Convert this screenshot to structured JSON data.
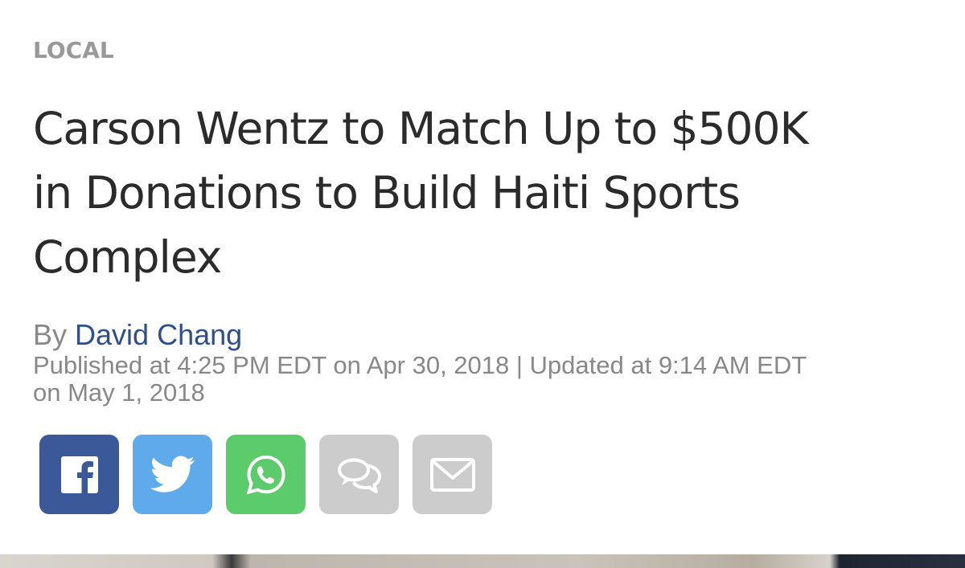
{
  "article": {
    "category": "LOCAL",
    "headline_lines": [
      "Carson Wentz to Match Up to $500K",
      "in Donations to Build Haiti Sports",
      "Complex"
    ],
    "byline_prefix": "By",
    "author": "David Chang",
    "dates_line1": "Published at 4:25 PM EDT on Apr 30, 2018 | Updated at 9:14 AM EDT",
    "dates_line2": "on May 1, 2018"
  },
  "share_buttons": [
    {
      "icon": "facebook-icon",
      "color": "#3b5998"
    },
    {
      "icon": "twitter-icon",
      "color": "#5eaaeb"
    },
    {
      "icon": "whatsapp-icon",
      "color": "#5ccb6b"
    },
    {
      "icon": "comments-icon",
      "color": "#cccccc"
    },
    {
      "icon": "email-icon",
      "color": "#cccccc"
    }
  ]
}
